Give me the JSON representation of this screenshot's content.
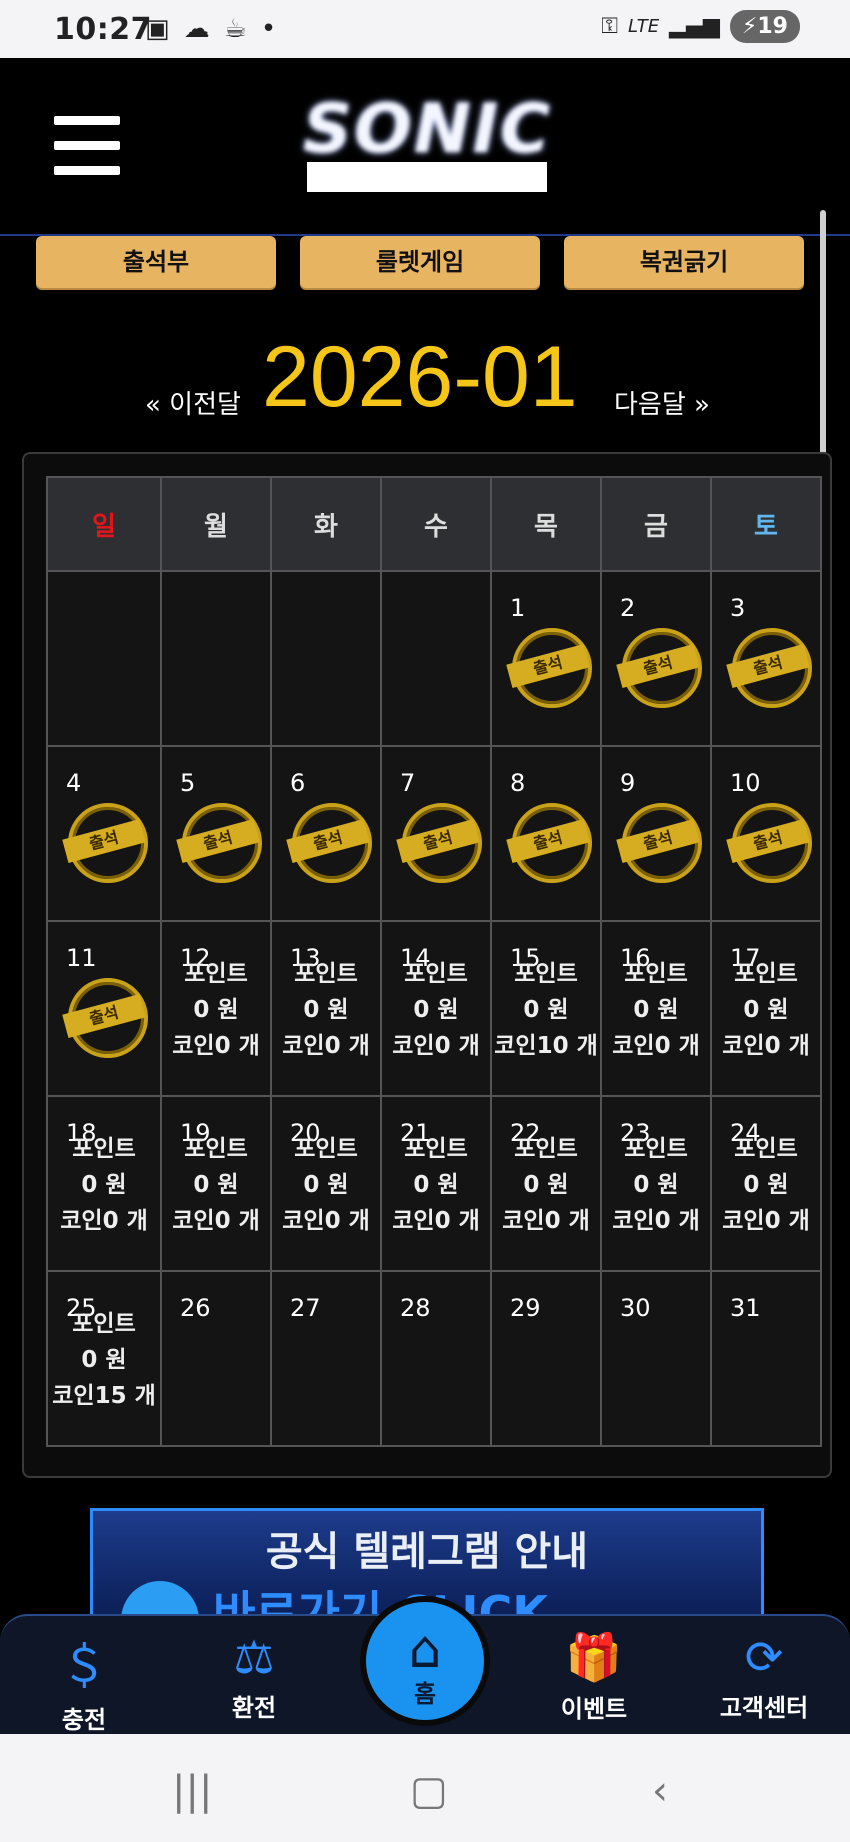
{
  "status_bar": {
    "time": "10:27",
    "left_icons": [
      "screenshot-icon",
      "cloud-icon",
      "coffee-icon",
      "dot-icon"
    ],
    "network": "LTE",
    "battery": "19"
  },
  "header": {
    "logo": "SONIC"
  },
  "top_buttons": [
    "출석부",
    "룰렛게임",
    "복권긁기"
  ],
  "month_nav": {
    "prev": "« 이전달",
    "month": "2026-01",
    "next": "다음달 »"
  },
  "calendar": {
    "weekdays": [
      "일",
      "월",
      "화",
      "수",
      "목",
      "금",
      "토"
    ],
    "weekday_colors": {
      "sun": "#e0161b",
      "sat": "#62b6ee"
    },
    "stamp_label": "출석",
    "point_label": "포인트",
    "won": "원",
    "coin_label": "코인",
    "count_unit": "개",
    "weeks": [
      [
        {
          "day": ""
        },
        {
          "day": ""
        },
        {
          "day": ""
        },
        {
          "day": ""
        },
        {
          "day": "1",
          "stamp": true
        },
        {
          "day": "2",
          "stamp": true
        },
        {
          "day": "3",
          "stamp": true
        }
      ],
      [
        {
          "day": "4",
          "stamp": true
        },
        {
          "day": "5",
          "stamp": true
        },
        {
          "day": "6",
          "stamp": true
        },
        {
          "day": "7",
          "stamp": true
        },
        {
          "day": "8",
          "stamp": true
        },
        {
          "day": "9",
          "stamp": true
        },
        {
          "day": "10",
          "stamp": true
        }
      ],
      [
        {
          "day": "11",
          "stamp": true
        },
        {
          "day": "12",
          "point": "0",
          "coin": "0"
        },
        {
          "day": "13",
          "point": "0",
          "coin": "0"
        },
        {
          "day": "14",
          "point": "0",
          "coin": "0"
        },
        {
          "day": "15",
          "point": "0",
          "coin": "10"
        },
        {
          "day": "16",
          "point": "0",
          "coin": "0"
        },
        {
          "day": "17",
          "point": "0",
          "coin": "0"
        }
      ],
      [
        {
          "day": "18",
          "point": "0",
          "coin": "0"
        },
        {
          "day": "19",
          "point": "0",
          "coin": "0"
        },
        {
          "day": "20",
          "point": "0",
          "coin": "0"
        },
        {
          "day": "21",
          "point": "0",
          "coin": "0"
        },
        {
          "day": "22",
          "point": "0",
          "coin": "0"
        },
        {
          "day": "23",
          "point": "0",
          "coin": "0"
        },
        {
          "day": "24",
          "point": "0",
          "coin": "0"
        }
      ],
      [
        {
          "day": "25",
          "point": "0",
          "coin": "15"
        },
        {
          "day": "26"
        },
        {
          "day": "27"
        },
        {
          "day": "28"
        },
        {
          "day": "29"
        },
        {
          "day": "30"
        },
        {
          "day": "31"
        }
      ]
    ]
  },
  "banner": {
    "title": "공식 텔레그램 안내",
    "subtitle": "바로가기 CLICK"
  },
  "bottom_nav": [
    {
      "label": "충전",
      "icon": "deposit-icon"
    },
    {
      "label": "환전",
      "icon": "withdraw-icon"
    },
    {
      "label": "홈",
      "icon": "home-icon"
    },
    {
      "label": "이벤트",
      "icon": "gift-icon"
    },
    {
      "label": "고객센터",
      "icon": "support-24-icon"
    }
  ],
  "colors": {
    "accent_gold": "#f5c518",
    "button_gold": "#e7b462",
    "nav_blue": "#1a93f0"
  }
}
